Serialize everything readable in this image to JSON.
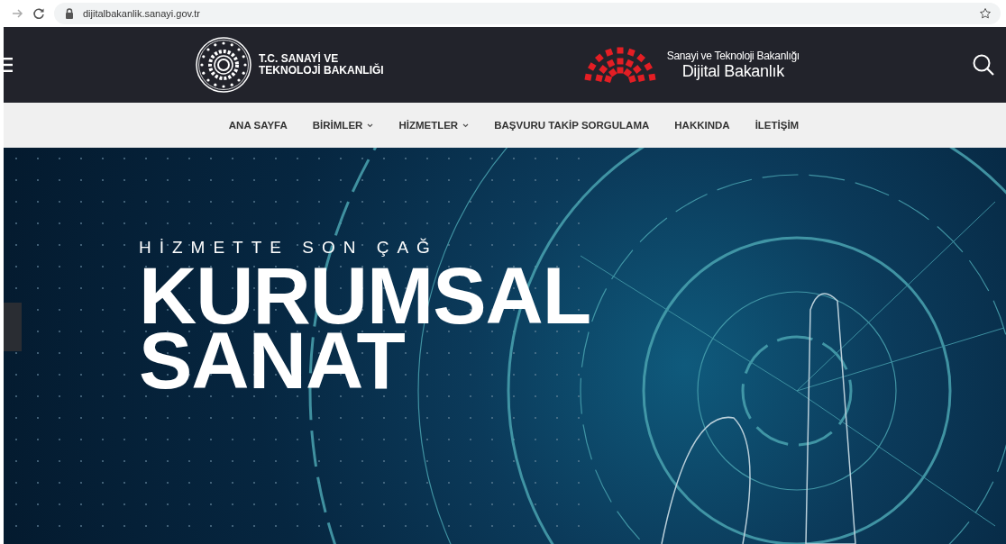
{
  "browser": {
    "url": "dijitalbakanlik.sanayi.gov.tr"
  },
  "header": {
    "ministry_logo_text": [
      "T.C. SANAYİ VE",
      "TEKNOLOJİ BAKANLIĞI"
    ],
    "digital_logo_subtitle": "Sanayi ve Teknoloji Bakanlığı",
    "digital_logo_title": "Dijital Bakanlık"
  },
  "nav": [
    {
      "label": "ANA SAYFA",
      "has_dropdown": false
    },
    {
      "label": "BİRİMLER",
      "has_dropdown": true
    },
    {
      "label": "HİZMETLER",
      "has_dropdown": true
    },
    {
      "label": "BAŞVURU TAKİP SORGULAMA",
      "has_dropdown": false
    },
    {
      "label": "HAKKINDA",
      "has_dropdown": false
    },
    {
      "label": "İLETİŞİM",
      "has_dropdown": false
    }
  ],
  "hero": {
    "eyebrow": "HİZMETTE SON ÇAĞ",
    "title_lines": [
      "KURUMSAL",
      "SANAT"
    ]
  }
}
